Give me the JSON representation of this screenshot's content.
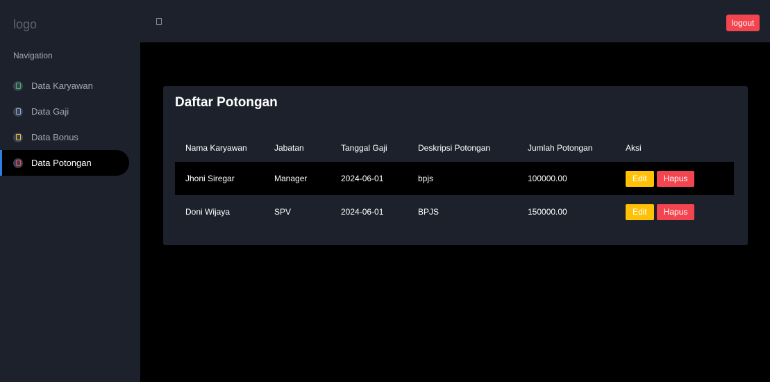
{
  "sidebar": {
    "logo": "logo",
    "nav_title": "Navigation",
    "items": [
      {
        "label": "Data Karyawan",
        "icon": "id-card-icon",
        "icon_color": "#3fb86a"
      },
      {
        "label": "Data Gaji",
        "icon": "money-icon",
        "icon_color": "#8fa9d8"
      },
      {
        "label": "Data Bonus",
        "icon": "gift-icon",
        "icon_color": "#f0c23a"
      },
      {
        "label": "Data Potongan",
        "icon": "scissors-icon",
        "icon_color": "#f3454f",
        "active": true
      }
    ]
  },
  "header": {
    "logout_label": "logout"
  },
  "main": {
    "title": "Daftar Potongan",
    "table": {
      "columns": [
        "Nama Karyawan",
        "Jabatan",
        "Tanggal Gaji",
        "Deskripsi Potongan",
        "Jumlah Potongan",
        "Aksi"
      ],
      "rows": [
        {
          "nama": "Jhoni Siregar",
          "jabatan": "Manager",
          "tanggal": "2024-06-01",
          "deskripsi": "bpjs",
          "jumlah": "100000.00"
        },
        {
          "nama": "Doni Wijaya",
          "jabatan": "SPV",
          "tanggal": "2024-06-01",
          "deskripsi": "BPJS",
          "jumlah": "150000.00"
        }
      ],
      "edit_label": "Edit",
      "delete_label": "Hapus"
    }
  },
  "colors": {
    "panel": "#1c212b",
    "danger": "#f3454f",
    "warning": "#ffc107",
    "active_accent": "#2f7fe0"
  }
}
